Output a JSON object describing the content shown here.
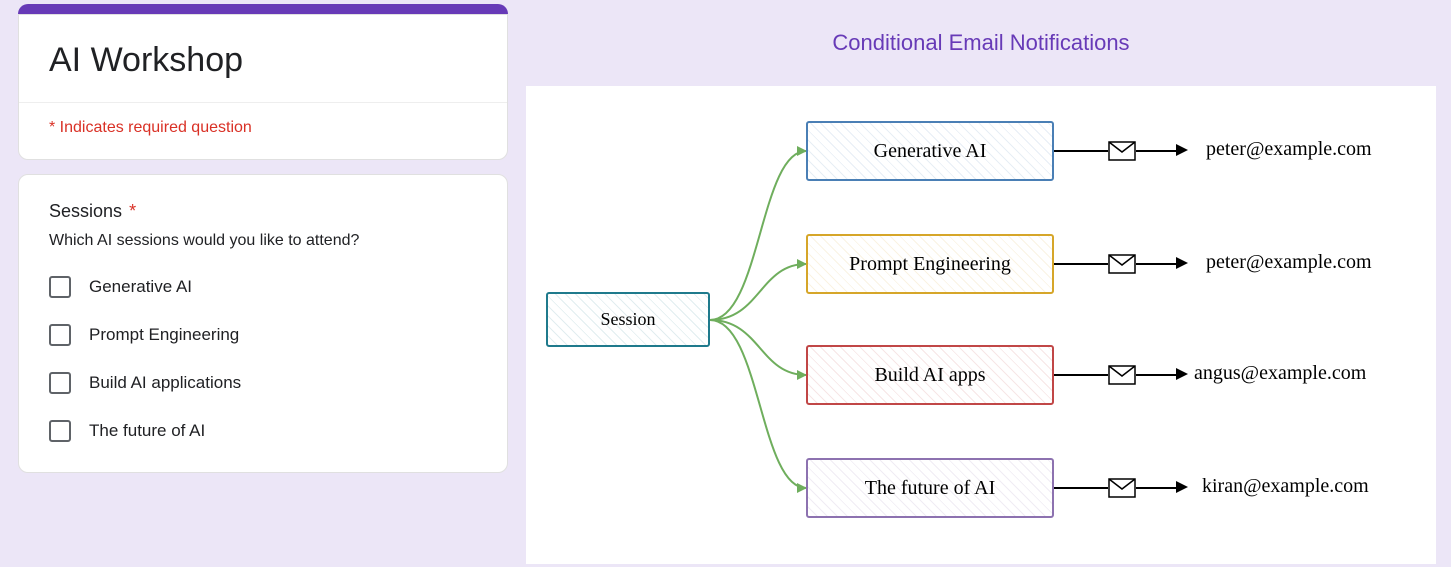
{
  "form": {
    "title": "AI Workshop",
    "required_note": "* Indicates required question",
    "question": {
      "label": "Sessions",
      "required_mark": "*",
      "description": "Which AI sessions would you like to attend?",
      "options": [
        "Generative AI",
        "Prompt Engineering",
        "Build AI applications",
        "The future of AI"
      ]
    }
  },
  "diagram": {
    "title": "Conditional Email Notifications",
    "root": "Session",
    "branches": [
      {
        "label": "Generative AI",
        "email": "peter@example.com"
      },
      {
        "label": "Prompt Engineering",
        "email": "peter@example.com"
      },
      {
        "label": "Build AI apps",
        "email": "angus@example.com"
      },
      {
        "label": "The future of AI",
        "email": "kiran@example.com"
      }
    ]
  }
}
